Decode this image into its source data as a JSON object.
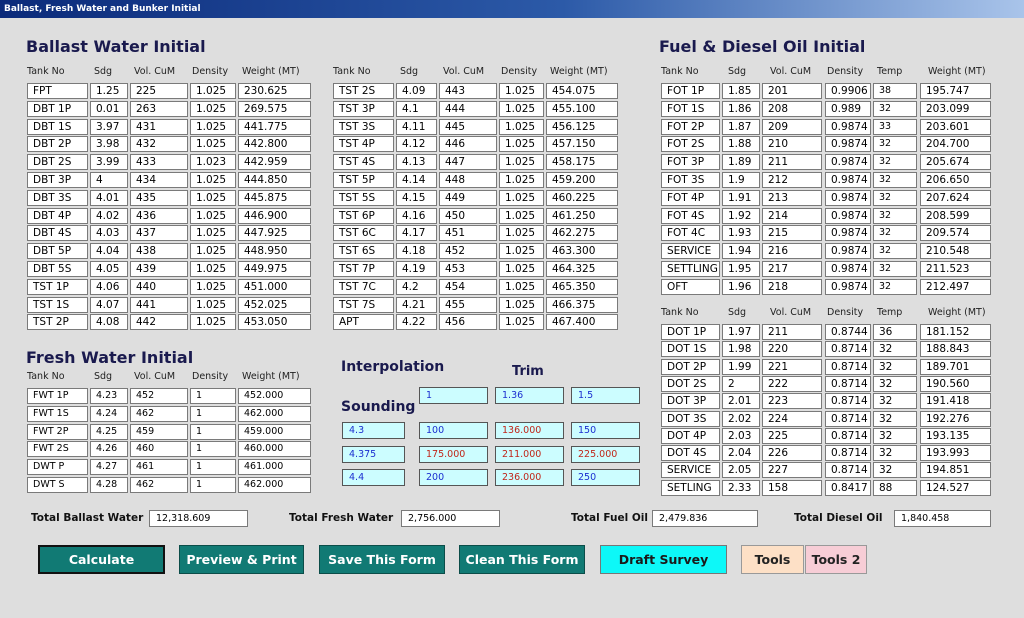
{
  "window": {
    "title": "Ballast, Fresh Water and Bunker Initial"
  },
  "ballast": {
    "title": "Ballast Water Initial",
    "headers": [
      "Tank No",
      "Sdg",
      "Vol. CuM",
      "Density",
      "Weight (MT)"
    ],
    "left": [
      [
        "FPT",
        "1.25",
        "225",
        "1.025",
        "230.625"
      ],
      [
        "DBT 1P",
        "0.01",
        "263",
        "1.025",
        "269.575"
      ],
      [
        "DBT 1S",
        "3.97",
        "431",
        "1.025",
        "441.775"
      ],
      [
        "DBT 2P",
        "3.98",
        "432",
        "1.025",
        "442.800"
      ],
      [
        "DBT 2S",
        "3.99",
        "433",
        "1.023",
        "442.959"
      ],
      [
        "DBT 3P",
        "4",
        "434",
        "1.025",
        "444.850"
      ],
      [
        "DBT 3S",
        "4.01",
        "435",
        "1.025",
        "445.875"
      ],
      [
        "DBT 4P",
        "4.02",
        "436",
        "1.025",
        "446.900"
      ],
      [
        "DBT 4S",
        "4.03",
        "437",
        "1.025",
        "447.925"
      ],
      [
        "DBT 5P",
        "4.04",
        "438",
        "1.025",
        "448.950"
      ],
      [
        "DBT 5S",
        "4.05",
        "439",
        "1.025",
        "449.975"
      ],
      [
        "TST 1P",
        "4.06",
        "440",
        "1.025",
        "451.000"
      ],
      [
        "TST 1S",
        "4.07",
        "441",
        "1.025",
        "452.025"
      ],
      [
        "TST 2P",
        "4.08",
        "442",
        "1.025",
        "453.050"
      ]
    ],
    "right": [
      [
        "TST 2S",
        "4.09",
        "443",
        "1.025",
        "454.075"
      ],
      [
        "TST 3P",
        "4.1",
        "444",
        "1.025",
        "455.100"
      ],
      [
        "TST 3S",
        "4.11",
        "445",
        "1.025",
        "456.125"
      ],
      [
        "TST 4P",
        "4.12",
        "446",
        "1.025",
        "457.150"
      ],
      [
        "TST 4S",
        "4.13",
        "447",
        "1.025",
        "458.175"
      ],
      [
        "TST 5P",
        "4.14",
        "448",
        "1.025",
        "459.200"
      ],
      [
        "TST 5S",
        "4.15",
        "449",
        "1.025",
        "460.225"
      ],
      [
        "TST 6P",
        "4.16",
        "450",
        "1.025",
        "461.250"
      ],
      [
        "TST 6C",
        "4.17",
        "451",
        "1.025",
        "462.275"
      ],
      [
        "TST 6S",
        "4.18",
        "452",
        "1.025",
        "463.300"
      ],
      [
        "TST 7P",
        "4.19",
        "453",
        "1.025",
        "464.325"
      ],
      [
        "TST 7C",
        "4.2",
        "454",
        "1.025",
        "465.350"
      ],
      [
        "TST 7S",
        "4.21",
        "455",
        "1.025",
        "466.375"
      ],
      [
        "APT",
        "4.22",
        "456",
        "1.025",
        "467.400"
      ]
    ]
  },
  "fresh": {
    "title": "Fresh Water Initial",
    "headers": [
      "Tank No",
      "Sdg",
      "Vol. CuM",
      "Density",
      "Weight (MT)"
    ],
    "rows": [
      [
        "FWT 1P",
        "4.23",
        "452",
        "1",
        "452.000"
      ],
      [
        "FWT 1S",
        "4.24",
        "462",
        "1",
        "462.000"
      ],
      [
        "FWT 2P",
        "4.25",
        "459",
        "1",
        "459.000"
      ],
      [
        "FWT 2S",
        "4.26",
        "460",
        "1",
        "460.000"
      ],
      [
        "DWT P",
        "4.27",
        "461",
        "1",
        "461.000"
      ],
      [
        "DWT S",
        "4.28",
        "462",
        "1",
        "462.000"
      ]
    ]
  },
  "interp": {
    "title": "Interpolation",
    "trim_label": "Trim",
    "sounding_label": "Sounding",
    "trim_values": [
      "1",
      "1.36",
      "1.5"
    ],
    "rows": [
      [
        "4.3",
        "100",
        "136.000",
        "150"
      ],
      [
        "4.375",
        "175.000",
        "211.000",
        "225.000"
      ],
      [
        "4.4",
        "200",
        "236.000",
        "250"
      ]
    ]
  },
  "fuel": {
    "title": "Fuel & Diesel Oil Initial",
    "fo_headers": [
      "Tank No",
      "Sdg",
      "Vol. CuM",
      "Density",
      "Temp",
      "Weight (MT)"
    ],
    "fo_rows": [
      [
        "FOT 1P",
        "1.85",
        "201",
        "0.9906",
        "38",
        "195.747"
      ],
      [
        "FOT 1S",
        "1.86",
        "208",
        "0.989",
        "32",
        "203.099"
      ],
      [
        "FOT 2P",
        "1.87",
        "209",
        "0.9874",
        "33",
        "203.601"
      ],
      [
        "FOT 2S",
        "1.88",
        "210",
        "0.9874",
        "32",
        "204.700"
      ],
      [
        "FOT 3P",
        "1.89",
        "211",
        "0.9874",
        "32",
        "205.674"
      ],
      [
        "FOT 3S",
        "1.9",
        "212",
        "0.9874",
        "32",
        "206.650"
      ],
      [
        "FOT 4P",
        "1.91",
        "213",
        "0.9874",
        "32",
        "207.624"
      ],
      [
        "FOT 4S",
        "1.92",
        "214",
        "0.9874",
        "32",
        "208.599"
      ],
      [
        "FOT 4C",
        "1.93",
        "215",
        "0.9874",
        "32",
        "209.574"
      ],
      [
        "SERVICE",
        "1.94",
        "216",
        "0.9874",
        "32",
        "210.548"
      ],
      [
        "SETTLING",
        "1.95",
        "217",
        "0.9874",
        "32",
        "211.523"
      ],
      [
        "OFT",
        "1.96",
        "218",
        "0.9874",
        "32",
        "212.497"
      ]
    ],
    "do_headers": [
      "Tank No",
      "Sdg",
      "Vol. CuM",
      "Density",
      "Temp",
      "Weight (MT)"
    ],
    "do_rows": [
      [
        "DOT 1P",
        "1.97",
        "211",
        "0.8744",
        "36",
        "181.152"
      ],
      [
        "DOT 1S",
        "1.98",
        "220",
        "0.8714",
        "32",
        "188.843"
      ],
      [
        "DOT 2P",
        "1.99",
        "221",
        "0.8714",
        "32",
        "189.701"
      ],
      [
        "DOT 2S",
        "2",
        "222",
        "0.8714",
        "32",
        "190.560"
      ],
      [
        "DOT 3P",
        "2.01",
        "223",
        "0.8714",
        "32",
        "191.418"
      ],
      [
        "DOT 3S",
        "2.02",
        "224",
        "0.8714",
        "32",
        "192.276"
      ],
      [
        "DOT 4P",
        "2.03",
        "225",
        "0.8714",
        "32",
        "193.135"
      ],
      [
        "DOT 4S",
        "2.04",
        "226",
        "0.8714",
        "32",
        "193.993"
      ],
      [
        "SERVICE",
        "2.05",
        "227",
        "0.8714",
        "32",
        "194.851"
      ],
      [
        "SETLING",
        "2.33",
        "158",
        "0.8417",
        "88",
        "124.527"
      ]
    ]
  },
  "totals": {
    "ballast_label": "Total Ballast Water",
    "ballast_value": "12,318.609",
    "fresh_label": "Total Fresh Water",
    "fresh_value": "2,756.000",
    "fuel_label": "Total Fuel Oil",
    "fuel_value": "2,479.836",
    "diesel_label": "Total Diesel Oil",
    "diesel_value": "1,840.458"
  },
  "buttons": {
    "calculate": "Calculate",
    "preview": "Preview & Print",
    "save": "Save This Form",
    "clean": "Clean This Form",
    "draft": "Draft Survey",
    "tools": "Tools",
    "tools2": "Tools 2"
  },
  "colors": {
    "teal": "#117a74",
    "cyan": "#0df8f8",
    "input_bg": "#ccfdff",
    "title_bar": "#0b2a7a"
  }
}
